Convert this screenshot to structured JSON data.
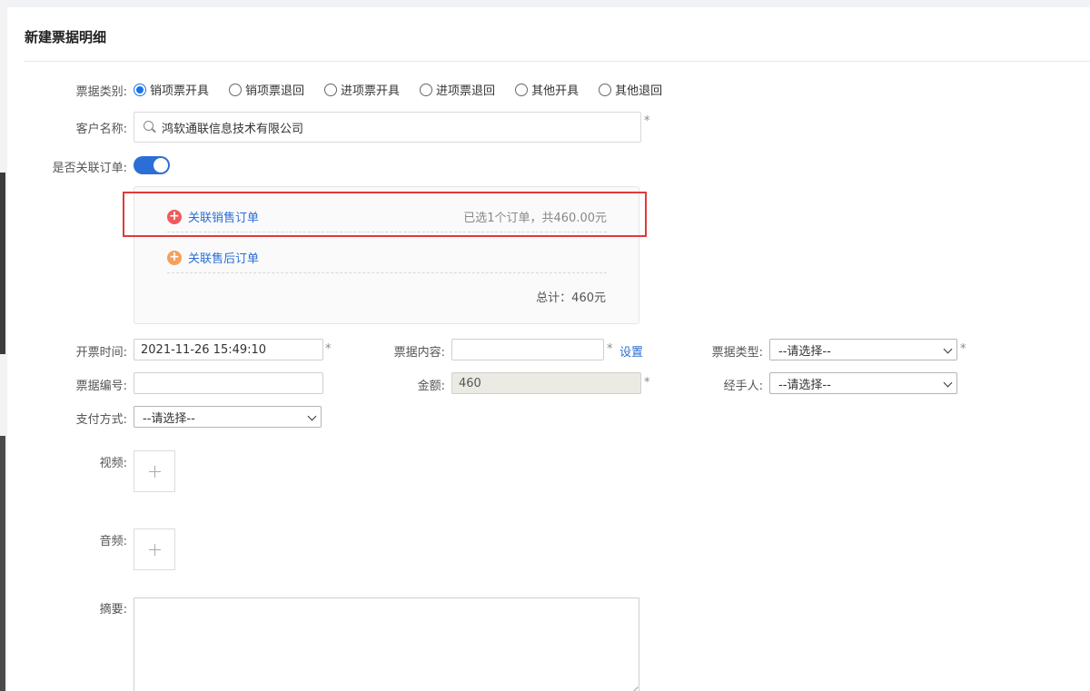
{
  "page": {
    "title": "新建票据明细"
  },
  "form": {
    "bill_category": {
      "label": "票据类别:",
      "options": [
        "销项票开具",
        "销项票退回",
        "进项票开具",
        "进项票退回",
        "其他开具",
        "其他退回"
      ],
      "selected": "销项票开具"
    },
    "customer": {
      "label": "客户名称:",
      "value": "鸿软通联信息技术有限公司",
      "required_mark": "*"
    },
    "link_order": {
      "label": "是否关联订单:",
      "enabled": true
    },
    "order_panel": {
      "sales_link": "关联销售订单",
      "sales_summary": "已选1个订单，共460.00元",
      "after_sales_link": "关联售后订单",
      "total": "总计：460元"
    },
    "invoice_time": {
      "label": "开票时间:",
      "value": "2021-11-26 15:49:10",
      "required_mark": "*"
    },
    "bill_content": {
      "label": "票据内容:",
      "value": "",
      "required_mark": "*",
      "settings": "设置"
    },
    "bill_type": {
      "label": "票据类型:",
      "value": "--请选择--",
      "required_mark": "*"
    },
    "bill_number": {
      "label": "票据编号:",
      "value": ""
    },
    "amount": {
      "label": "金额:",
      "value": "460",
      "required_mark": "*"
    },
    "handler": {
      "label": "经手人:",
      "value": "--请选择--"
    },
    "payment": {
      "label": "支付方式:",
      "value": "--请选择--"
    },
    "video": {
      "label": "视频:"
    },
    "audio": {
      "label": "音频:"
    },
    "summary": {
      "label": "摘要:"
    }
  },
  "colors": {
    "accent": "#2b6fd6",
    "highlight": "#e03a3a",
    "sales_plus": "#f05a5a",
    "after_plus": "#f5a05a"
  }
}
